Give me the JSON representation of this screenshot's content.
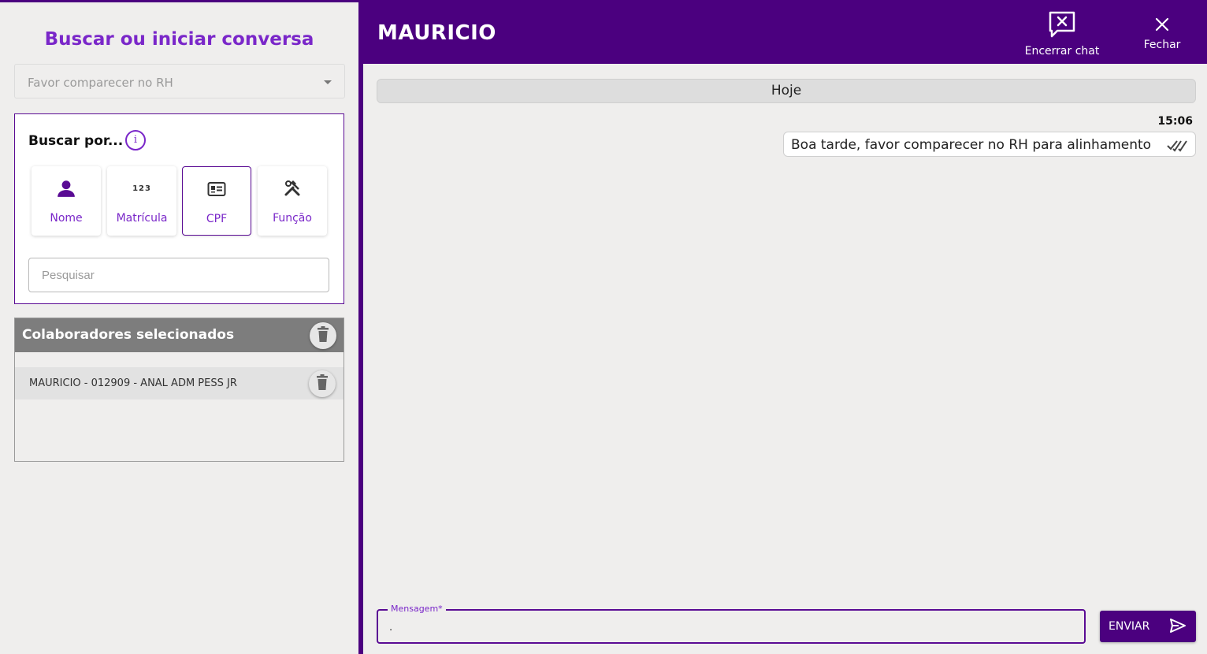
{
  "left": {
    "title": "Buscar ou iniciar conversa",
    "select_value": "Favor comparecer no RH",
    "search_by_label": "Buscar por...",
    "info_icon": "info-icon",
    "options": [
      {
        "label": "Nome",
        "icon": "person-icon"
      },
      {
        "label": "Matrícula",
        "icon": "number-icon"
      },
      {
        "label": "CPF",
        "icon": "id-card-icon",
        "selected": true
      },
      {
        "label": "Função",
        "icon": "tools-icon"
      }
    ],
    "search_placeholder": "Pesquisar",
    "selected_title": "Colaboradores selecionados",
    "selected_items": [
      {
        "text": "MAURICIO - 012909 - ANAL ADM PESS JR"
      }
    ]
  },
  "chat": {
    "contact_name": "MAURICIO",
    "end_chat_label": "Encerrar chat",
    "close_label": "Fechar",
    "day_label": "Hoje",
    "messages": [
      {
        "time": "15:06",
        "text": "Boa tarde, favor comparecer no RH para alinhamento",
        "status": "double-check-icon"
      }
    ],
    "input_label": "Mensagem*",
    "input_value": ".",
    "send_label": "ENVIAR"
  },
  "colors": {
    "primary": "#4b007f",
    "accent": "#7a27c9",
    "background": "#efeeed"
  }
}
